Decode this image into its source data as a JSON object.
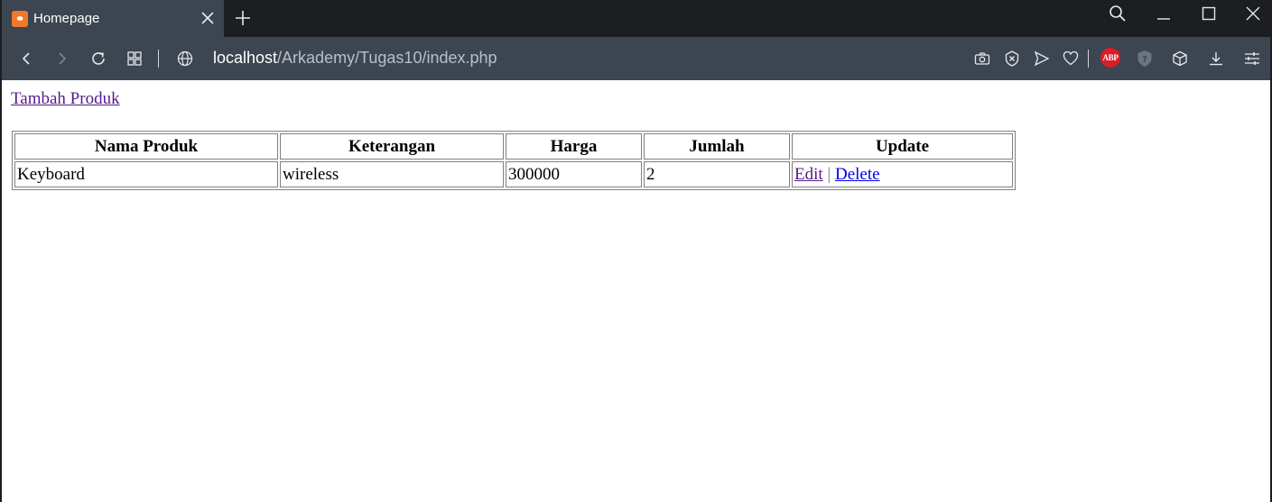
{
  "browser": {
    "tab": {
      "title": "Homepage",
      "favicon": "xampp-icon"
    },
    "url": {
      "host": "localhost",
      "path": "/Arkademy/Tugas10/index.php"
    },
    "extensions": {
      "abp_label": "ABP"
    }
  },
  "page": {
    "add_link": "Tambah Produk",
    "table": {
      "headers": [
        "Nama Produk",
        "Keterangan",
        "Harga",
        "Jumlah",
        "Update"
      ],
      "rows": [
        {
          "nama": "Keyboard",
          "keterangan": "wireless",
          "harga": "300000",
          "jumlah": "2",
          "edit": "Edit",
          "separator": "|",
          "delete": "Delete"
        }
      ]
    }
  },
  "colors": {
    "chrome_dark": "#1c1e22",
    "chrome": "#3c4550",
    "link_visited": "#551a8b",
    "link": "#0000ee"
  }
}
